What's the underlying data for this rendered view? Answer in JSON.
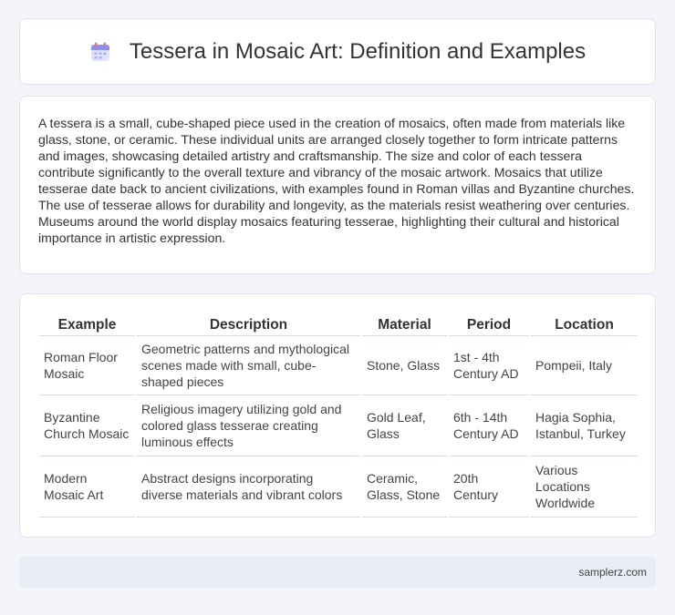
{
  "header": {
    "title": "Tessera in Mosaic Art: Definition and Examples",
    "icon": "calendar-icon"
  },
  "intro": {
    "text": "A tessera is a small, cube-shaped piece used in the creation of mosaics, often made from materials like glass, stone, or ceramic. These individual units are arranged closely together to form intricate patterns and images, showcasing detailed artistry and craftsmanship. The size and color of each tessera contribute significantly to the overall texture and vibrancy of the mosaic artwork. Mosaics that utilize tesserae date back to ancient civilizations, with examples found in Roman villas and Byzantine churches. The use of tesserae allows for durability and longevity, as the materials resist weathering over centuries. Museums around the world display mosaics featuring tesserae, highlighting their cultural and historical importance in artistic expression."
  },
  "table": {
    "headers": [
      "Example",
      "Description",
      "Material",
      "Period",
      "Location"
    ],
    "rows": [
      [
        "Roman Floor Mosaic",
        "Geometric patterns and mythological scenes made with small, cube-shaped pieces",
        "Stone, Glass",
        "1st - 4th Century AD",
        "Pompeii, Italy"
      ],
      [
        "Byzantine Church Mosaic",
        "Religious imagery utilizing gold and colored glass tesserae creating luminous effects",
        "Gold Leaf, Glass",
        "6th - 14th Century AD",
        "Hagia Sophia, Istanbul, Turkey"
      ],
      [
        "Modern Mosaic Art",
        "Abstract designs incorporating diverse materials and vibrant colors",
        "Ceramic, Glass, Stone",
        "20th Century",
        "Various Locations Worldwide"
      ]
    ]
  },
  "footer": {
    "site": "samplerz.com"
  }
}
